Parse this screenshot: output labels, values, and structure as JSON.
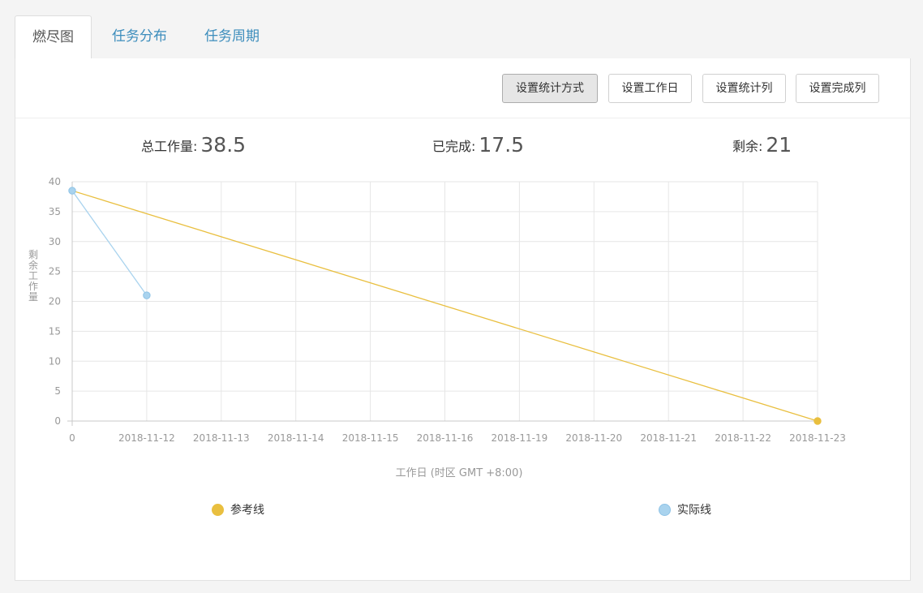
{
  "tabs": [
    {
      "label": "燃尽图",
      "active": true
    },
    {
      "label": "任务分布",
      "active": false
    },
    {
      "label": "任务周期",
      "active": false
    }
  ],
  "toolbar": {
    "buttons": [
      "设置统计方式",
      "设置工作日",
      "设置统计列",
      "设置完成列"
    ],
    "active_button": "设置统计方式"
  },
  "stats": {
    "total_label": "总工作量:",
    "total_value": "38.5",
    "done_label": "已完成:",
    "done_value": "17.5",
    "remaining_label": "剩余:",
    "remaining_value": "21"
  },
  "colors": {
    "reference": "#e9bf3f",
    "actual": "#a9d3ee",
    "actual_border": "#8fc3e6",
    "grid": "#e6e6e6",
    "axis": "#c8c8c8",
    "tick_text": "#999999",
    "link": "#3c8dbc"
  },
  "chart_data": {
    "type": "line",
    "xlabel": "工作日 (时区 GMT +8:00)",
    "ylabel": "剩余工作量",
    "categories": [
      "0",
      "2018-11-12",
      "2018-11-13",
      "2018-11-14",
      "2018-11-15",
      "2018-11-16",
      "2018-11-19",
      "2018-11-20",
      "2018-11-21",
      "2018-11-22",
      "2018-11-23"
    ],
    "ylim": [
      0,
      40
    ],
    "yticks": [
      0,
      5,
      10,
      15,
      20,
      25,
      30,
      35,
      40
    ],
    "grid": true,
    "legend_position": "bottom",
    "series": [
      {
        "name": "参考线",
        "points": [
          [
            "0",
            38.5
          ],
          [
            "2018-11-23",
            0
          ]
        ],
        "color": "#e9bf3f"
      },
      {
        "name": "实际线",
        "points": [
          [
            "0",
            38.5
          ],
          [
            "2018-11-12",
            21
          ]
        ],
        "color": "#a9d3ee"
      }
    ]
  }
}
